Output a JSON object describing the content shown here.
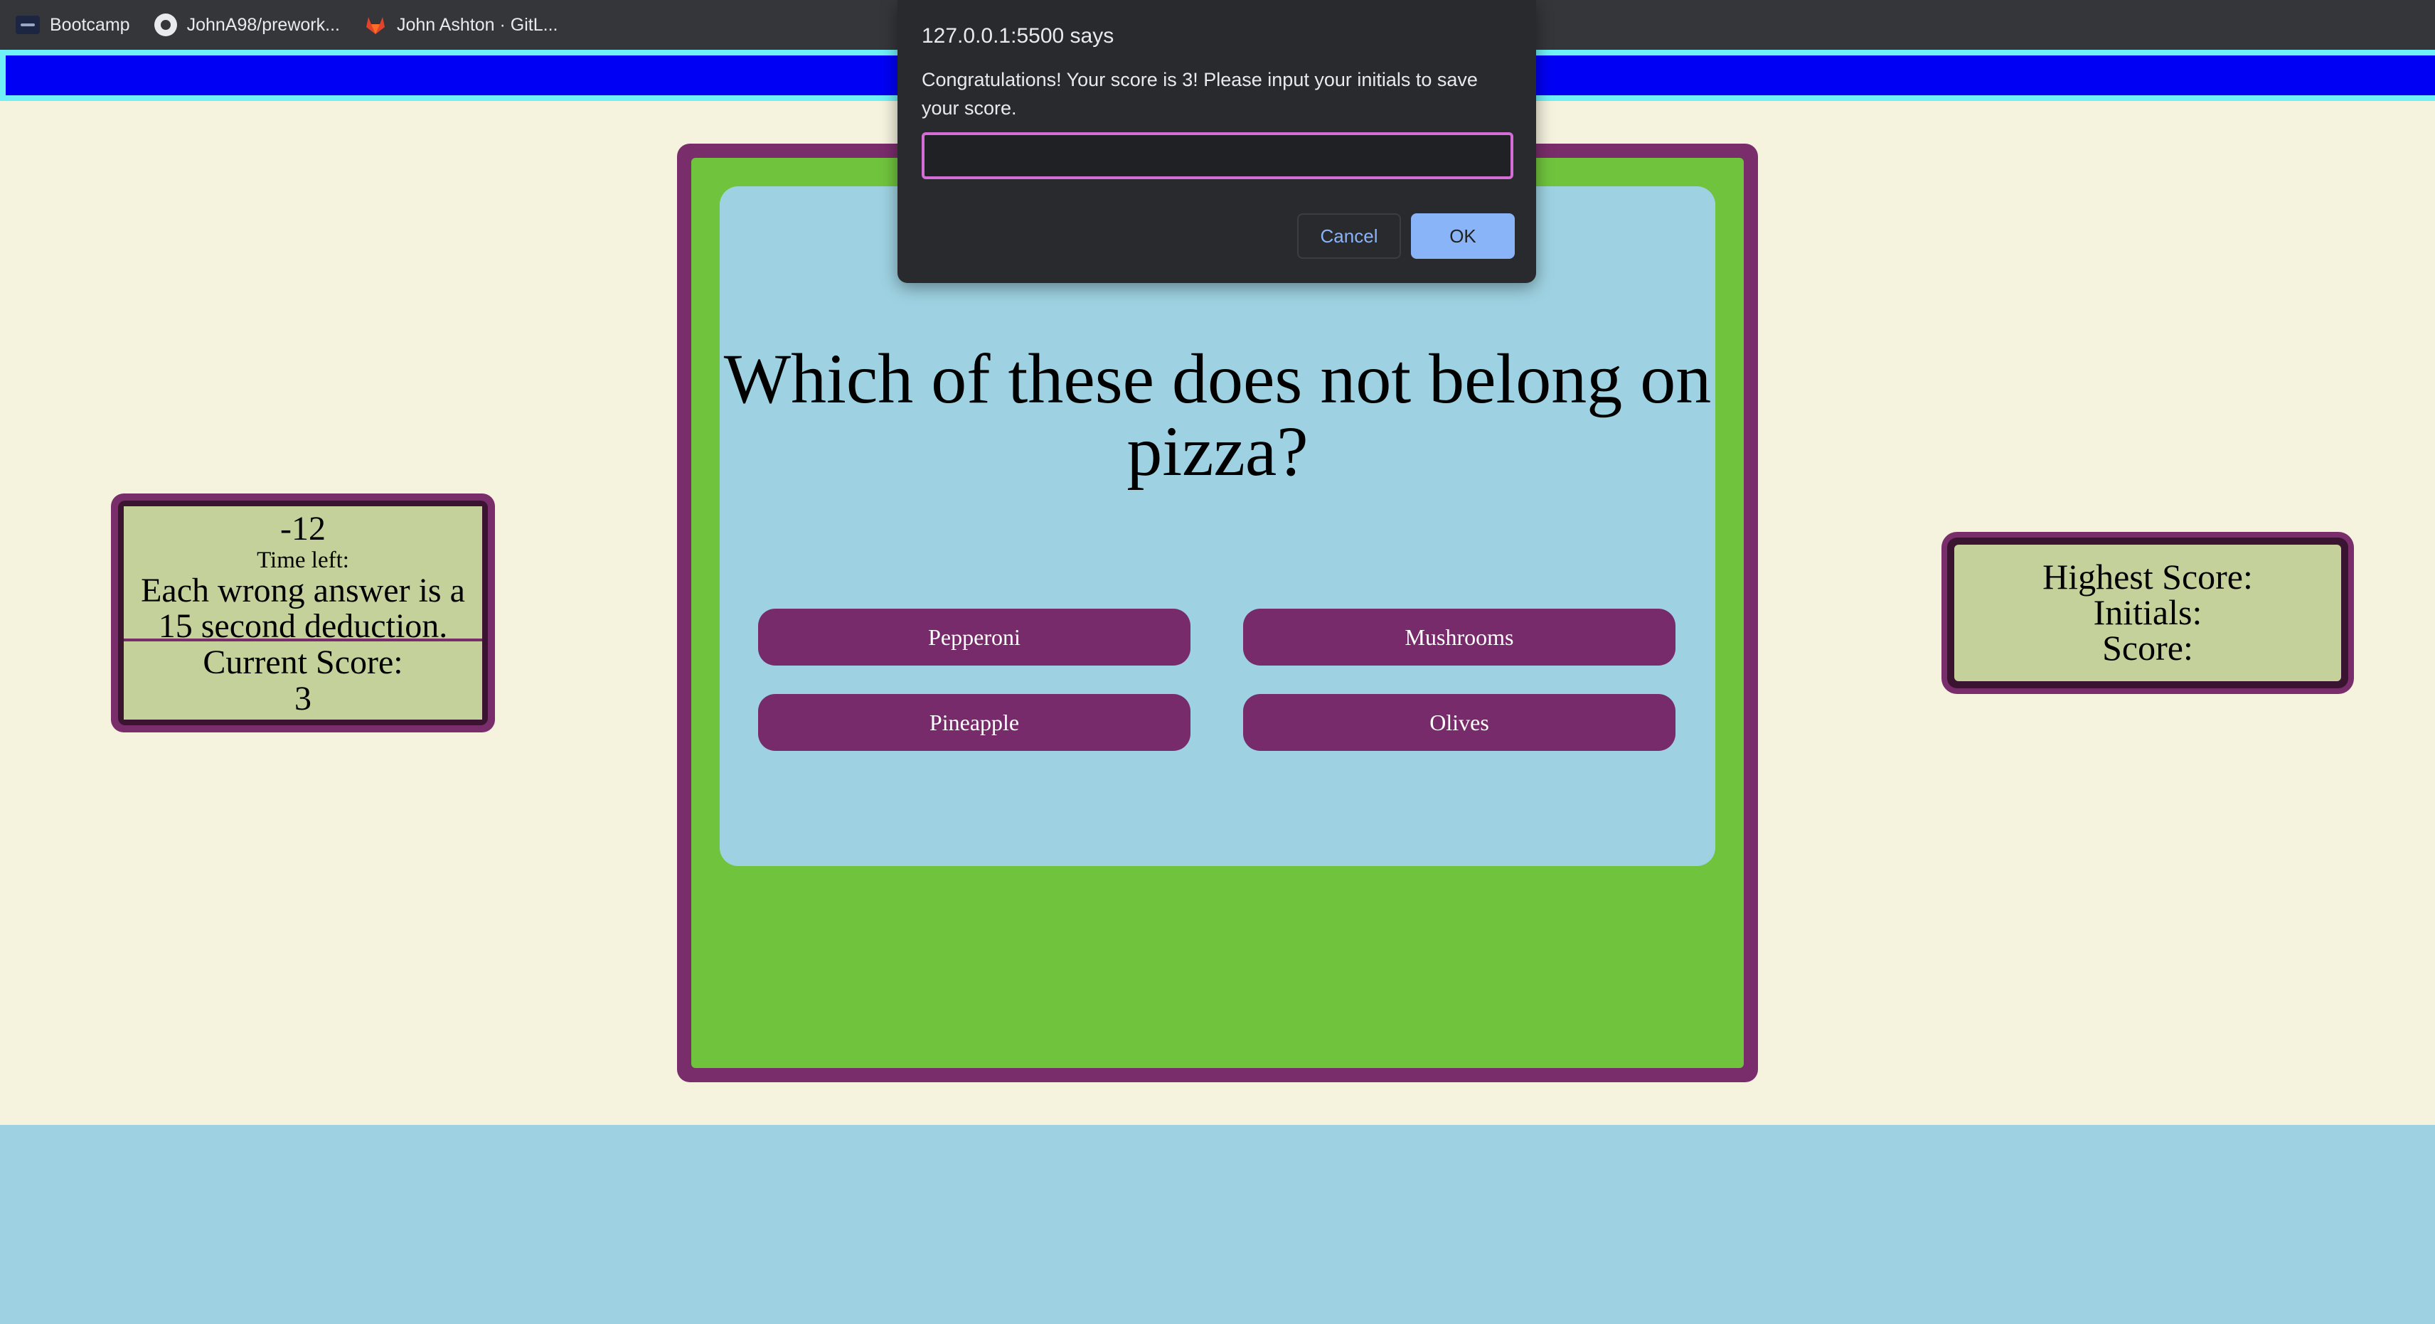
{
  "bookmarks": {
    "items": [
      {
        "label": "Bootcamp",
        "icon": "bootcamp-icon"
      },
      {
        "label": "JohnA98/prework...",
        "icon": "github-icon"
      },
      {
        "label": "John Ashton · GitL...",
        "icon": "gitlab-icon"
      }
    ]
  },
  "timer": {
    "value": "-12",
    "label": "Time left:",
    "note": "Each wrong answer is a 15 second deduction.",
    "score_label": "Current Score:",
    "score_value": "3"
  },
  "highscore": {
    "title": "Highest Score:",
    "initials_label": "Initials:",
    "score_label": "Score:"
  },
  "quiz": {
    "question": "Which of these does not belong on pizza?",
    "answers": [
      "Pepperoni",
      "Mushrooms",
      "Pineapple",
      "Olives"
    ]
  },
  "dialog": {
    "title": "127.0.0.1:5500 says",
    "message": "Congratulations! Your score is 3! Please input your initials to save your score.",
    "input_value": "",
    "cancel_label": "Cancel",
    "ok_label": "OK"
  },
  "colors": {
    "header_blue": "#0000f5",
    "header_border": "#6ff0f7",
    "purple": "#772b6a",
    "green": "#70c43d",
    "panel_blue": "#9ed2e2",
    "score_bg": "#c5d19a",
    "background": "#f5f3de"
  }
}
